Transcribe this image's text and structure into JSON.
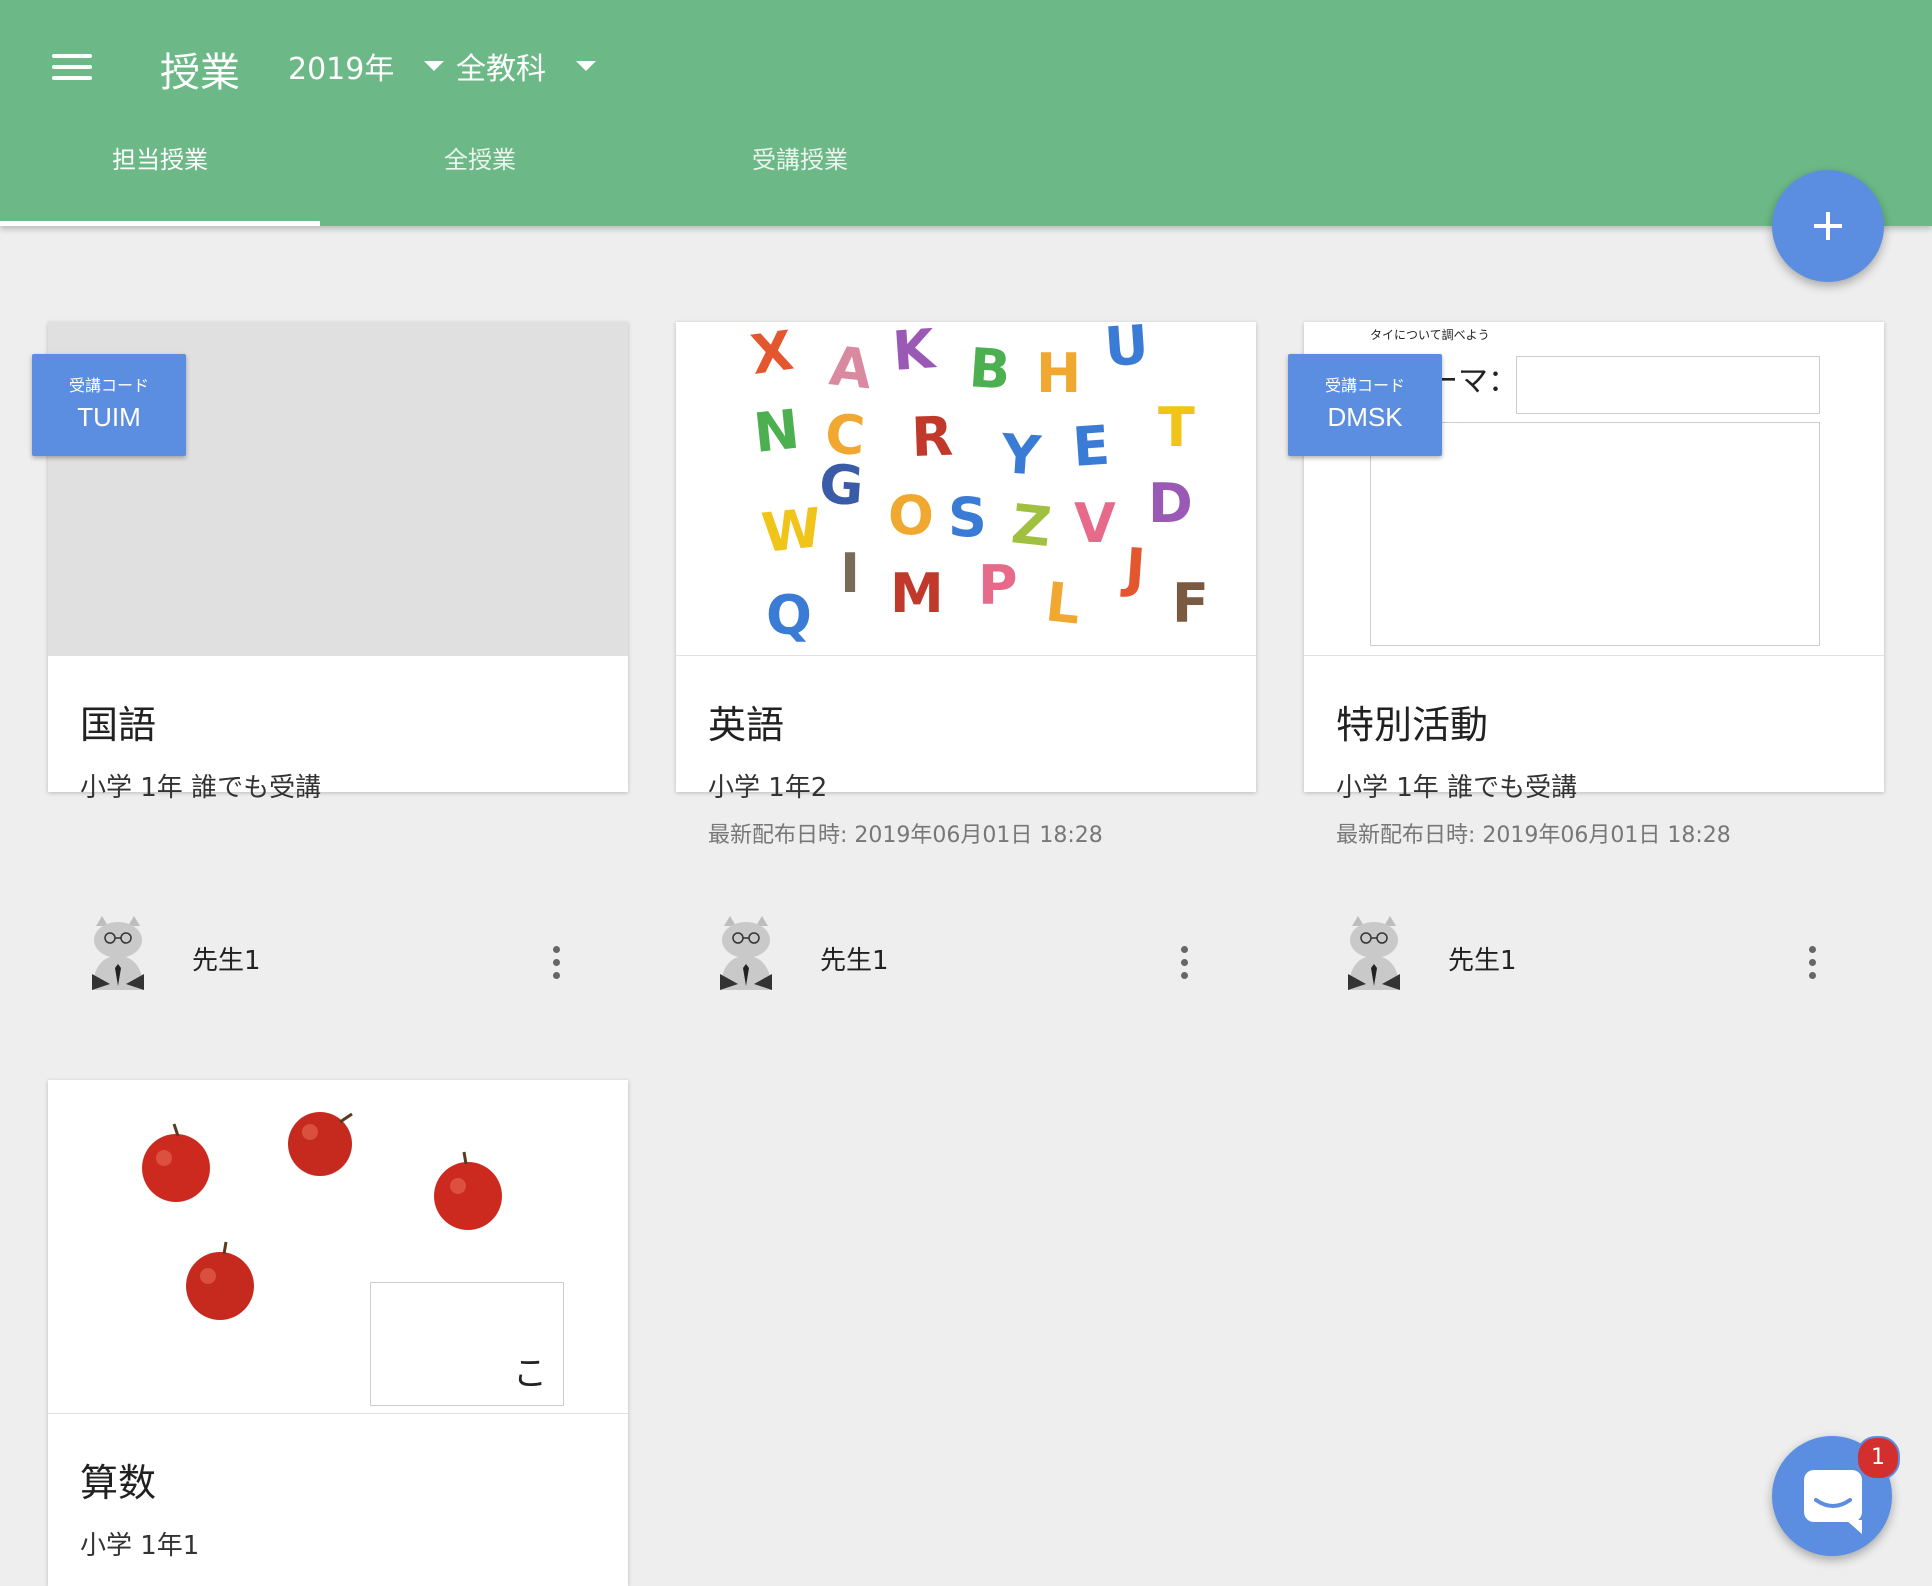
{
  "header": {
    "title": "授業",
    "year": "2019年",
    "subject_filter": "全教科",
    "tabs": [
      {
        "label": "担当授業",
        "active": true
      },
      {
        "label": "全授業",
        "active": false
      },
      {
        "label": "受講授業",
        "active": false
      }
    ]
  },
  "colors": {
    "appbar": "#6cb987",
    "accent": "#5b8ee0",
    "notification": "#d32f2f"
  },
  "cards": [
    {
      "title": "国語",
      "subtitle": "小学 1年 誰でも受講",
      "date": "",
      "teacher": "先生1",
      "badge": {
        "label": "受講コード",
        "code": "TUIM"
      }
    },
    {
      "title": "英語",
      "subtitle": "小学 1年2",
      "date": "最新配布日時: 2019年06月01日 18:28",
      "teacher": "先生1",
      "thumb_letters": [
        "X",
        "A",
        "K",
        "B",
        "H",
        "U",
        "N",
        "C",
        "R",
        "Y",
        "E",
        "T",
        "G",
        "O",
        "S",
        "Z",
        "V",
        "D",
        "W",
        "I",
        "M",
        "P",
        "L",
        "J",
        "F",
        "Q"
      ]
    },
    {
      "title": "特別活動",
      "subtitle": "小学 1年 誰でも受講",
      "date": "最新配布日時: 2019年06月01日 18:28",
      "teacher": "先生1",
      "badge": {
        "label": "受講コード",
        "code": "DMSK"
      },
      "thumb_caption": "タイについて調べよう",
      "thumb_field": "ーマ："
    },
    {
      "title": "算数",
      "subtitle": "小学 1年1",
      "teacher": "",
      "thumb_box_char": "こ"
    }
  ],
  "chat": {
    "unread": "1"
  }
}
